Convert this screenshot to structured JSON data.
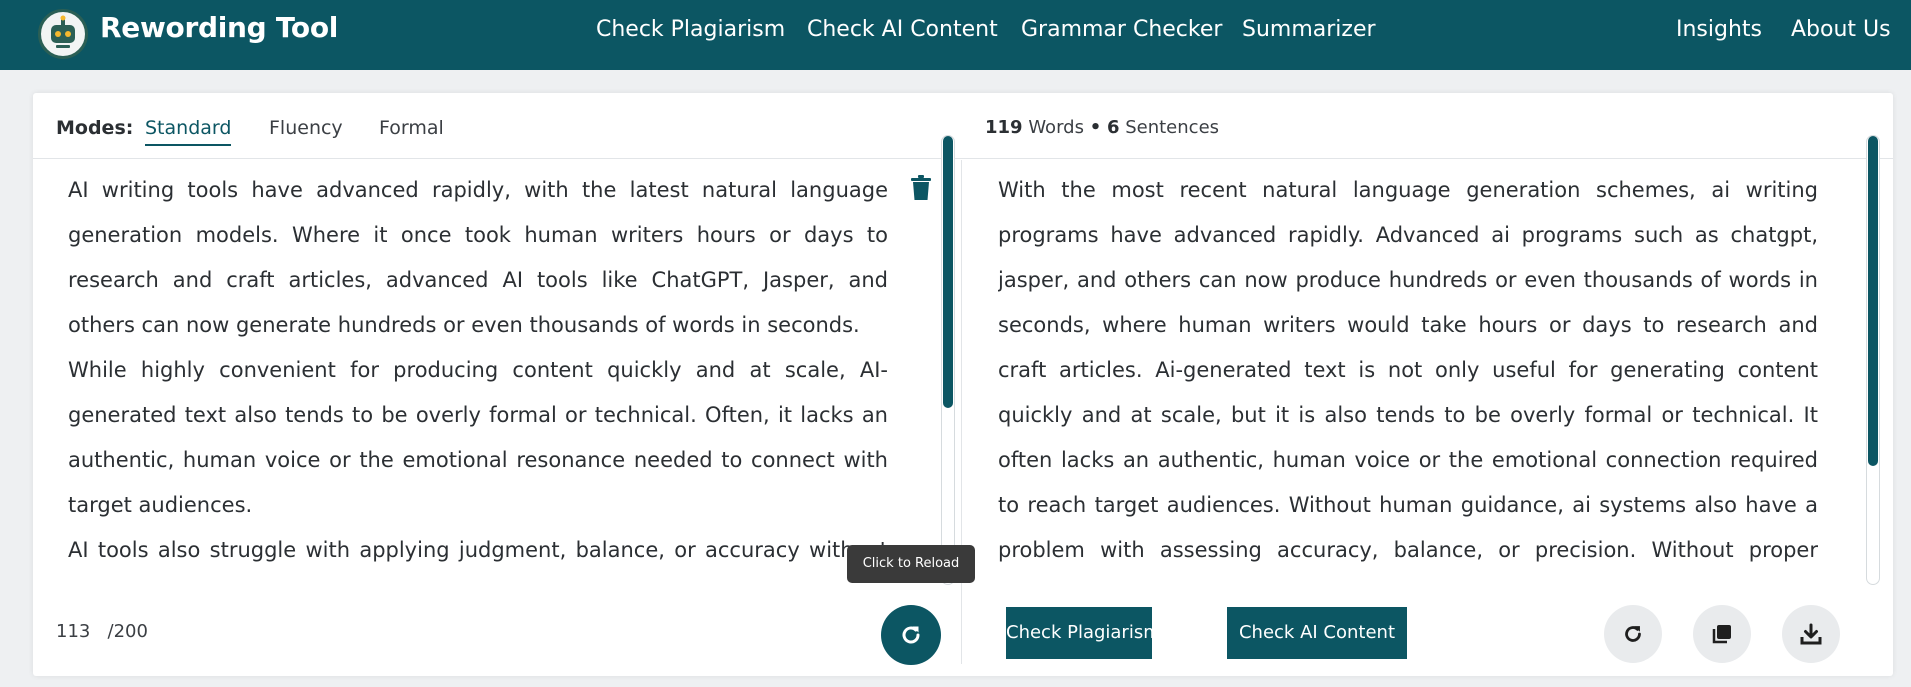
{
  "header": {
    "brand": "Rewording Tool",
    "nav": [
      {
        "label": "Check Plagiarism"
      },
      {
        "label": "Check AI Content"
      },
      {
        "label": "Grammar Checker"
      },
      {
        "label": "Summarizer"
      },
      {
        "label": "Insights"
      },
      {
        "label": "About Us"
      }
    ]
  },
  "modes": {
    "label": "Modes:",
    "tabs": [
      {
        "label": "Standard",
        "active": true
      },
      {
        "label": "Fluency",
        "active": false
      },
      {
        "label": "Formal",
        "active": false
      }
    ]
  },
  "stats": {
    "words_count": "119",
    "words_label": "Words",
    "separator": "•",
    "sentences_count": "6",
    "sentences_label": "Sentences"
  },
  "input": {
    "paragraphs": [
      "AI writing tools have advanced rapidly, with the latest natural language generation models. Where it once took human writers hours or days to research and craft articles, advanced AI tools like ChatGPT, Jasper, and others can now generate hundreds or even thousands of words in seconds.",
      "While highly convenient for producing content quickly and at scale, AI-generated text also tends to be overly formal or technical. Often, it lacks an authentic, human voice or the emotional resonance needed to connect with target audiences.",
      "AI tools also struggle with applying judgment, balance, or accuracy without human guidance. No complete context and fine nuances leaving gaps"
    ],
    "word_count": "113",
    "word_limit": "/200"
  },
  "output": {
    "text": "With the most recent natural language generation schemes, ai writing programs have advanced rapidly. Advanced ai programs such as chatgpt, jasper, and others can now produce hundreds or even thousands of words in seconds, where human writers would take hours or days to research and craft articles. Ai-generated text is not only useful for generating content quickly and at scale, but it is also tends to be overly formal or technical. It often lacks an authentic, human voice or the emotional connection required to reach target audiences. Without human guidance, ai systems also have a problem with assessing accuracy, balance, or precision. Without proper context, complete nuance and fine can leave gaps that are detected in machine"
  },
  "tooltip": "Click to Reload",
  "buttons": {
    "check_plagiarism": "Check Plagiarism",
    "check_ai_content": "Check AI Content"
  },
  "icons": {
    "logo": "robot-logo-icon",
    "trash": "trash-icon",
    "reload": "reload-icon",
    "copy": "copy-icon",
    "download": "download-icon"
  },
  "colors": {
    "brand": "#0c5663",
    "header_bg": "#0c5663",
    "page_bg": "#eef0f2"
  }
}
